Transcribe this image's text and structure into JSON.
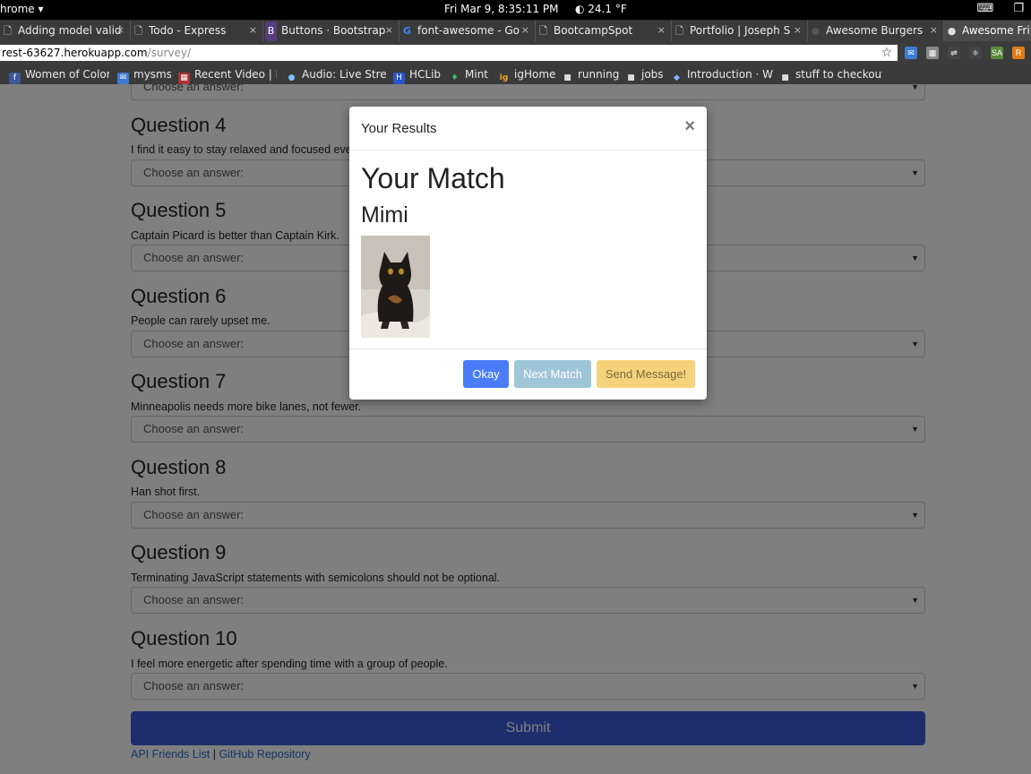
{
  "os": {
    "app_menu": "hrome ▾",
    "clock": "Fri Mar 9, 8:35:11 PM",
    "weather": "◐ 24.1 °F"
  },
  "tabs": [
    {
      "label": "Adding model valid",
      "favicon": "doc-icon"
    },
    {
      "label": "Todo - Express",
      "favicon": "doc-icon"
    },
    {
      "label": "Buttons · Bootstrap",
      "favicon": "bootstrap-icon"
    },
    {
      "label": "font-awesome - Go",
      "favicon": "google-icon"
    },
    {
      "label": "BootcampSpot",
      "favicon": "doc-icon"
    },
    {
      "label": "Portfolio | Joseph S",
      "favicon": "doc-icon"
    },
    {
      "label": "Awesome Burgers",
      "favicon": "github-icon"
    },
    {
      "label": "Awesome Fri",
      "favicon": "github-icon"
    }
  ],
  "url": {
    "host": "rest-63627.herokuapp.com",
    "path": "/survey/"
  },
  "bookmarks": [
    {
      "label": "Women of Color"
    },
    {
      "label": "mysms"
    },
    {
      "label": "Recent Video | P"
    },
    {
      "label": "Audio: Live Strea"
    },
    {
      "label": "HCLib"
    },
    {
      "label": "Mint"
    },
    {
      "label": "igHome"
    },
    {
      "label": "running"
    },
    {
      "label": "jobs"
    },
    {
      "label": "Introduction · W"
    },
    {
      "label": "stuff to checkout"
    }
  ],
  "survey": {
    "placeholder": "Choose an answer:",
    "questions": [
      {
        "title": "Question 4",
        "text": "I find it easy to stay relaxed and focused even when there is some pressure."
      },
      {
        "title": "Question 5",
        "text": "Captain Picard is better than Captain Kirk."
      },
      {
        "title": "Question 6",
        "text": "People can rarely upset me."
      },
      {
        "title": "Question 7",
        "text": "Minneapolis needs more bike lanes, not fewer."
      },
      {
        "title": "Question 8",
        "text": "Han shot first."
      },
      {
        "title": "Question 9",
        "text": "Terminating JavaScript statements with semicolons should not be optional."
      },
      {
        "title": "Question 10",
        "text": "I feel more energetic after spending time with a group of people."
      }
    ],
    "submit_label": "Submit",
    "footer": {
      "api_link": "API Friends List",
      "separator": "|",
      "github_link": "GitHub Repository"
    }
  },
  "modal": {
    "title": "Your Results",
    "close": "×",
    "heading": "Your Match",
    "match_name": "Mimi",
    "buttons": {
      "okay": "Okay",
      "next": "Next Match",
      "send": "Send Message!"
    }
  },
  "colors": {
    "primary": "#4a7cf7",
    "info": "#9fc5d8",
    "warning": "#f5d37a",
    "submit": "#3b5bdb"
  }
}
